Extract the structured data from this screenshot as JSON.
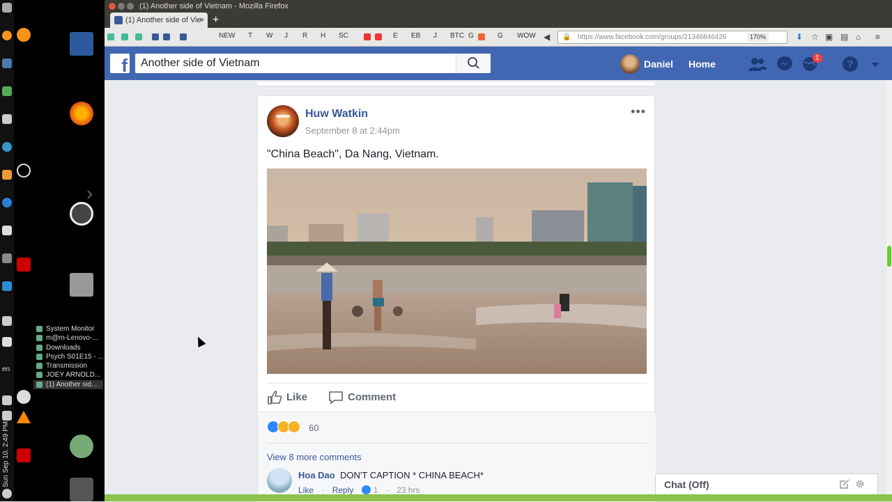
{
  "system": {
    "language": "en",
    "clock": "Sun Sep 10, 2:49 PM",
    "taskbar": [
      "System Monitor",
      "m@m-Lenovo-...",
      "Downloads",
      "Psych S01E15 - ...",
      "Transmission",
      "JOEY ARNOLD...",
      "(1) Another sid..."
    ]
  },
  "browser": {
    "window_title": "(1) Another side of Vietnam - Mozilla Firefox",
    "tab_label": "(1) Another side of Vie",
    "url": "https://www.facebook.com/groups/21346846426",
    "zoom": "170%",
    "bookmarks": [
      "NEW",
      "T",
      "W",
      "J",
      "R",
      "H",
      "SC",
      "E",
      "EB",
      "J",
      "BTC",
      "G",
      "G",
      "WOW"
    ]
  },
  "facebook": {
    "search_value": "Another side of Vietnam",
    "user_name": "Daniel",
    "home_label": "Home",
    "notification_count": "1"
  },
  "post": {
    "author": "Huw Watkin",
    "date": "September 8 at 2:44pm",
    "text": "\"China Beach\", Da Nang, Vietnam.",
    "like_label": "Like",
    "comment_label": "Comment",
    "reaction_count": "60",
    "view_more": "View 8 more comments",
    "comment": {
      "author": "Hoa Dao",
      "text": "DON'T CAPTION * CHINA BEACH*",
      "like": "Like",
      "reply": "Reply",
      "likes": "1",
      "time": "23 hrs"
    }
  },
  "chat": {
    "label": "Chat (Off)"
  }
}
